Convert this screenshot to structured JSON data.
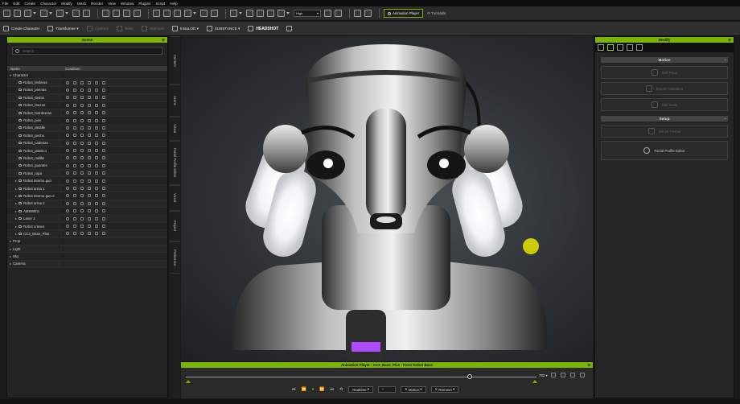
{
  "menu": [
    "File",
    "Edit",
    "Create",
    "Character",
    "Modify",
    "Mesh",
    "Render",
    "View",
    "Window",
    "Plugins",
    "Script",
    "Help"
  ],
  "toolbar": {
    "quality": "High",
    "animation_player_label": "Animation Player",
    "turntable_label": "Turntable"
  },
  "toolbar2": {
    "create_character": "Create Character",
    "transformer": "Transformer",
    "conform": "Conform",
    "bake": "Bake",
    "optimize": "Optimize",
    "instalod": "InstaLOD",
    "substance": "SUBSTANCE",
    "headshot": "HEADSHOT"
  },
  "scene": {
    "title": "Scene",
    "search_placeholder": "Search",
    "col_name": "Name",
    "col_condition": "Condition",
    "root": "Character",
    "items": [
      {
        "label": "Robot_bisferas",
        "expand": ""
      },
      {
        "label": "Robot_piernas",
        "expand": ""
      },
      {
        "label": "Robot_dedos",
        "expand": ""
      },
      {
        "label": "Robot_brazos",
        "expand": ""
      },
      {
        "label": "Robot_hombreras",
        "expand": ""
      },
      {
        "label": "Robot_pies",
        "expand": ""
      },
      {
        "label": "Robot_detalle",
        "expand": ""
      },
      {
        "label": "Robot_pecho",
        "expand": ""
      },
      {
        "label": "Robot_cadenas",
        "expand": ""
      },
      {
        "label": "Robot_plastico",
        "expand": ""
      },
      {
        "label": "Robot_rodilla",
        "expand": ""
      },
      {
        "label": "Robot_guantes",
        "expand": ""
      },
      {
        "label": "Robot_ropa",
        "expand": ""
      },
      {
        "label": "Robot interno gun",
        "expand": "▸"
      },
      {
        "label": "Robot arma 1",
        "expand": "▸"
      },
      {
        "label": "Robot interno gun 2",
        "expand": "▸"
      },
      {
        "label": "Robot arma 2",
        "expand": "▸"
      },
      {
        "label": "AM5Wkh1",
        "expand": "▸"
      },
      {
        "label": "Laser 1",
        "expand": "▸"
      },
      {
        "label": "Robot craneo",
        "expand": "▸"
      },
      {
        "label": "CC3_Base_Plus",
        "expand": "▸"
      }
    ],
    "groups": [
      "Prop",
      "Light",
      "Sky",
      "Camera"
    ]
  },
  "side_tabs": [
    "Content",
    "Scene",
    "Visual",
    "Facial Profile Editor",
    "Visual",
    "Project",
    "Preference"
  ],
  "animation_player": {
    "title": "Animation Player : CC3_Base_Plus : Fotor Robot Base",
    "frame": "792",
    "realtime": "Realtime",
    "motion": "Motion",
    "remove": "Remove",
    "progress": 0.81
  },
  "modify": {
    "title": "Modify",
    "motion_section": "Motion",
    "motion_buttons": [
      "Edit Pose",
      "Export Animation",
      "Edit Gaits"
    ],
    "setup_section": "Setup",
    "setup_buttons": [
      "Set as T-Pose",
      "Facial Profile Editor"
    ]
  },
  "colors": {
    "accent": "#7bb500",
    "cursor": "#e6e600"
  }
}
